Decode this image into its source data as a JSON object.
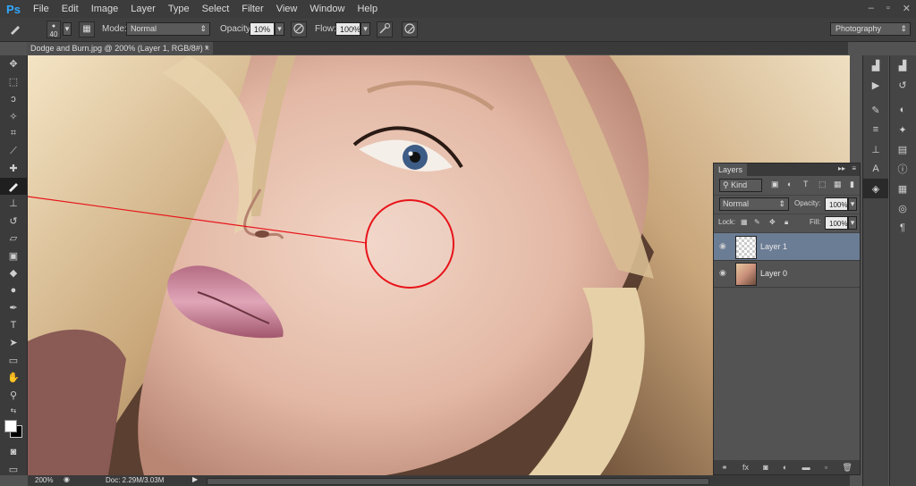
{
  "app": {
    "logo": "Ps"
  },
  "menu": [
    "File",
    "Edit",
    "Image",
    "Layer",
    "Type",
    "Select",
    "Filter",
    "View",
    "Window",
    "Help"
  ],
  "window_controls": {
    "minimize": "–",
    "restore": "▫",
    "close": "✕"
  },
  "options": {
    "brush_size": "40",
    "mode_label": "Mode:",
    "mode_value": "Normal",
    "opacity_label": "Opacity:",
    "opacity_value": "10%",
    "flow_label": "Flow:",
    "flow_value": "100%",
    "workspace": "Photography"
  },
  "document_tab": {
    "title": "Dodge and Burn.jpg @ 200% (Layer 1, RGB/8#) *",
    "close": "×"
  },
  "status": {
    "zoom": "200%",
    "doc": "Doc: 2.29M/3.03M"
  },
  "layers_panel": {
    "tab": "Layers",
    "kind_label": "Kind",
    "blend_mode": "Normal",
    "opacity_label": "Opacity:",
    "opacity_value": "100%",
    "lock_label": "Lock:",
    "fill_label": "Fill:",
    "fill_value": "100%",
    "layers": [
      {
        "name": "Layer 1",
        "selected": true,
        "thumb": "transparent"
      },
      {
        "name": "Layer 0",
        "selected": false,
        "thumb": "photo"
      }
    ]
  },
  "colors": {
    "accent": "#31a8ff",
    "selection": "#6b7c95",
    "highlight_circle": "#e8141a"
  }
}
